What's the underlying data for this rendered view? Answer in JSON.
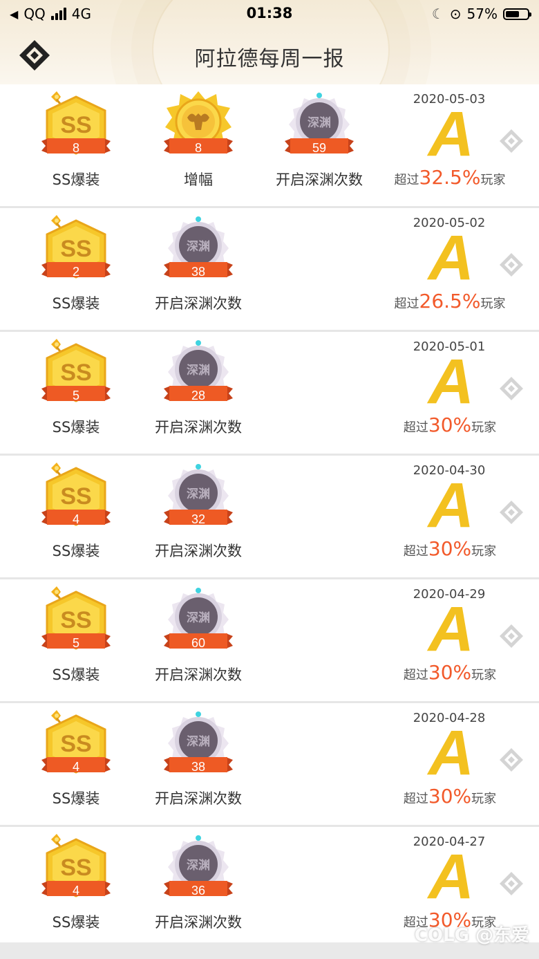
{
  "status_bar": {
    "carrier": "QQ",
    "network": "4G",
    "time": "01:38",
    "battery": "57%"
  },
  "header": {
    "title": "阿拉德每周一报"
  },
  "rows": [
    {
      "date": "2020-05-03",
      "grade": "A",
      "rank_prefix": "超过",
      "rank_pct": "32.5%",
      "rank_suffix": "玩家",
      "badges": [
        {
          "type": "ss",
          "count": "8",
          "label": "SS爆装"
        },
        {
          "type": "amplify",
          "count": "8",
          "label": "增幅"
        },
        {
          "type": "abyss",
          "count": "59",
          "label": "开启深渊次数"
        }
      ]
    },
    {
      "date": "2020-05-02",
      "grade": "A",
      "rank_prefix": "超过",
      "rank_pct": "26.5%",
      "rank_suffix": "玩家",
      "badges": [
        {
          "type": "ss",
          "count": "2",
          "label": "SS爆装"
        },
        {
          "type": "abyss",
          "count": "38",
          "label": "开启深渊次数"
        }
      ]
    },
    {
      "date": "2020-05-01",
      "grade": "A",
      "rank_prefix": "超过",
      "rank_pct": "30%",
      "rank_suffix": "玩家",
      "badges": [
        {
          "type": "ss",
          "count": "5",
          "label": "SS爆装"
        },
        {
          "type": "abyss",
          "count": "28",
          "label": "开启深渊次数"
        }
      ]
    },
    {
      "date": "2020-04-30",
      "grade": "A",
      "rank_prefix": "超过",
      "rank_pct": "30%",
      "rank_suffix": "玩家",
      "badges": [
        {
          "type": "ss",
          "count": "4",
          "label": "SS爆装"
        },
        {
          "type": "abyss",
          "count": "32",
          "label": "开启深渊次数"
        }
      ]
    },
    {
      "date": "2020-04-29",
      "grade": "A",
      "rank_prefix": "超过",
      "rank_pct": "30%",
      "rank_suffix": "玩家",
      "badges": [
        {
          "type": "ss",
          "count": "5",
          "label": "SS爆装"
        },
        {
          "type": "abyss",
          "count": "60",
          "label": "开启深渊次数"
        }
      ]
    },
    {
      "date": "2020-04-28",
      "grade": "A",
      "rank_prefix": "超过",
      "rank_pct": "30%",
      "rank_suffix": "玩家",
      "badges": [
        {
          "type": "ss",
          "count": "4",
          "label": "SS爆装"
        },
        {
          "type": "abyss",
          "count": "38",
          "label": "开启深渊次数"
        }
      ]
    },
    {
      "date": "2020-04-27",
      "grade": "A",
      "rank_prefix": "超过",
      "rank_pct": "30%",
      "rank_suffix": "玩家",
      "badges": [
        {
          "type": "ss",
          "count": "4",
          "label": "SS爆装"
        },
        {
          "type": "abyss",
          "count": "36",
          "label": "开启深渊次数"
        }
      ]
    }
  ],
  "badge_icons": {
    "ss": "ss-medal-icon",
    "amplify": "amplify-medal-icon",
    "abyss": "abyss-medal-icon"
  },
  "badge_art": {
    "ss": "SS",
    "abyss": "深渊"
  },
  "watermark": "COLG @东爱",
  "colors": {
    "grade": "#f3c120",
    "percent": "#f25a2b",
    "ribbon": "#ee5a24",
    "divider": "#e6e6e6"
  }
}
